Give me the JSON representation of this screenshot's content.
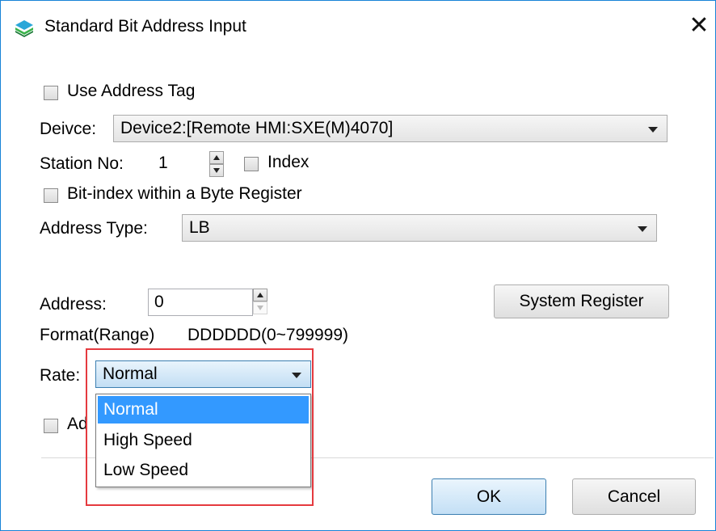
{
  "window": {
    "title": "Standard Bit Address Input",
    "close_glyph": "✕",
    "icon": "app-layers-icon"
  },
  "use_address_tag": {
    "label": "Use Address Tag",
    "checked": false
  },
  "device": {
    "label": "Deivce:",
    "value": "Device2:[Remote HMI:SXE(M)4070]"
  },
  "station": {
    "label": "Station No:",
    "value": "1"
  },
  "index": {
    "label": "Index",
    "checked": false
  },
  "bit_index": {
    "label": "Bit-index within a Byte Register",
    "checked": false
  },
  "address_type": {
    "label": "Address Type:",
    "value": "LB"
  },
  "address": {
    "label": "Address:",
    "value": "0"
  },
  "system_register": {
    "label": "System Register"
  },
  "format": {
    "label": "Format(Range)",
    "value": "DDDDDD(0~799999)"
  },
  "rate": {
    "label": "Rate:",
    "value": "Normal",
    "options": [
      "Normal",
      "High Speed",
      "Low Speed"
    ],
    "selected_index": 0
  },
  "partial_checkbox_label": "Ad",
  "buttons": {
    "ok": "OK",
    "cancel": "Cancel"
  },
  "colors": {
    "selection": "#3399ff",
    "highlight_box": "#e53a3f",
    "window_border": "#1883d7"
  }
}
